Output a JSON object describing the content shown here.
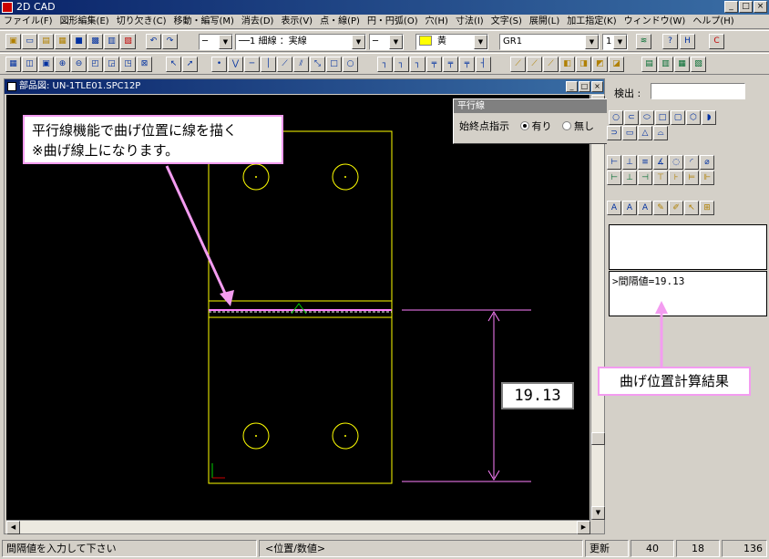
{
  "window": {
    "title": "2D CAD",
    "min": "_",
    "max": "□",
    "close": "×"
  },
  "menu": [
    "ファイル(F)",
    "図形編集(E)",
    "切り欠き(C)",
    "移動・編写(M)",
    "消去(D)",
    "表示(V)",
    "点・線(P)",
    "円・円弧(O)",
    "穴(H)",
    "寸法(I)",
    "文字(S)",
    "展開(L)",
    "加工指定(K)",
    "ウィンドウ(W)",
    "ヘルプ(H)"
  ],
  "toolbar": {
    "linestyle_left": "─",
    "linetype": "──1 細線 ：実線",
    "linewidth": "─",
    "color_name": "黄",
    "layer": "GR1",
    "layer_num": "1"
  },
  "doc_window": {
    "title": "部品図: UN-1TLE01.SPC12P"
  },
  "search": {
    "label": "検出 :",
    "value": ""
  },
  "output": {
    "line1": "",
    "line2": ">間隔値=19.13"
  },
  "popup": {
    "title": "平行線",
    "label": "始終点指示",
    "opt_yes": "有り",
    "opt_no": "無し"
  },
  "annotations": {
    "top_line1": "平行線機能で曲げ位置に線を描く",
    "top_line2": "※曲げ線上になります。",
    "bottom": "曲げ位置計算結果",
    "dim_value": "19.13"
  },
  "status": {
    "prompt": "間隔値を入力して下さい",
    "mode": "<位置/数値>",
    "action": "更新",
    "v1": "40",
    "v2": "18",
    "v3": "136"
  },
  "colors": {
    "canvas": "#000000",
    "geometry": "#ffff00",
    "dimension": "#ff80ff",
    "annotation_border": "#f39cf0",
    "bend_line": "#ff80ff",
    "marker": "#00cc00"
  }
}
